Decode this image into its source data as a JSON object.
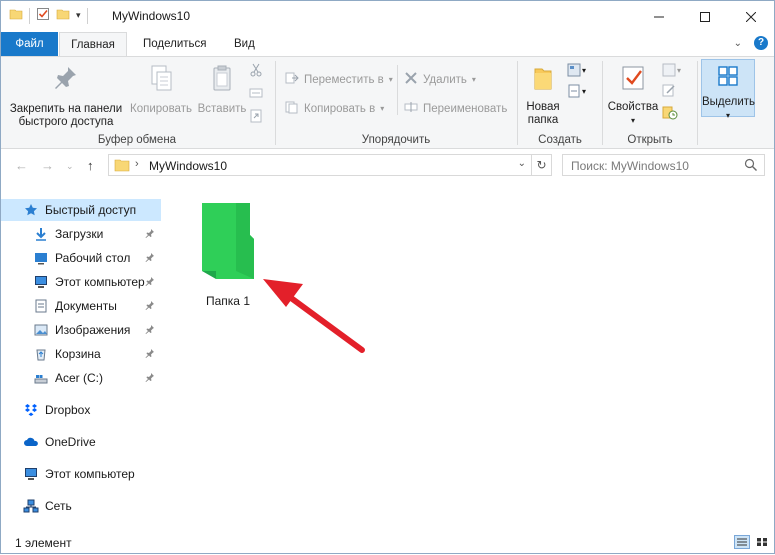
{
  "window": {
    "title": "MyWindows10",
    "controls": [
      "minimize",
      "maximize",
      "close"
    ]
  },
  "ribbon_tabs": {
    "file": "Файл",
    "home": "Главная",
    "share": "Поделиться",
    "view": "Вид"
  },
  "ribbon": {
    "clipboard": {
      "pin": "Закрепить на панели быстрого доступа",
      "pin_line1": "Закрепить на панели",
      "pin_line2": "быстрого доступа",
      "copy": "Копировать",
      "paste": "Вставить",
      "group_label": "Буфер обмена"
    },
    "organize": {
      "move_to": "Переместить в",
      "copy_to": "Копировать в",
      "delete": "Удалить",
      "rename": "Переименовать",
      "group_label": "Упорядочить"
    },
    "new": {
      "new_folder_line1": "Новая",
      "new_folder_line2": "папка",
      "group_label": "Создать"
    },
    "open": {
      "properties": "Свойства",
      "group_label": "Открыть"
    },
    "select": {
      "select_label": "Выделить"
    }
  },
  "address": {
    "path": "MyWindows10",
    "search_placeholder": "Поиск: MyWindows10"
  },
  "nav_pane": {
    "items": [
      {
        "label": "Быстрый доступ",
        "icon": "star-icon",
        "pinned": false
      },
      {
        "label": "Загрузки",
        "icon": "download-icon",
        "pinned": true
      },
      {
        "label": "Рабочий стол",
        "icon": "desktop-icon",
        "pinned": true
      },
      {
        "label": "Этот компьютер",
        "icon": "computer-icon",
        "pinned": true
      },
      {
        "label": "Документы",
        "icon": "documents-icon",
        "pinned": true
      },
      {
        "label": "Изображения",
        "icon": "pictures-icon",
        "pinned": true
      },
      {
        "label": "Корзина",
        "icon": "recycle-bin-icon",
        "pinned": true
      },
      {
        "label": "Acer (C:)",
        "icon": "drive-icon",
        "pinned": true
      },
      {
        "label": "Dropbox",
        "icon": "dropbox-icon",
        "pinned": false
      },
      {
        "label": "OneDrive",
        "icon": "onedrive-icon",
        "pinned": false
      },
      {
        "label": "Этот компьютер",
        "icon": "computer-icon",
        "pinned": false
      },
      {
        "label": "Сеть",
        "icon": "network-icon",
        "pinned": false
      }
    ]
  },
  "content": {
    "items": [
      {
        "name": "Папка 1",
        "type": "folder",
        "color": "#2fcf58"
      }
    ]
  },
  "status": {
    "count": "1 элемент"
  },
  "colors": {
    "accent": "#1979ca",
    "selection": "#cce8ff",
    "folder_green": "#2fcf58",
    "arrow_red": "#e3202a"
  }
}
